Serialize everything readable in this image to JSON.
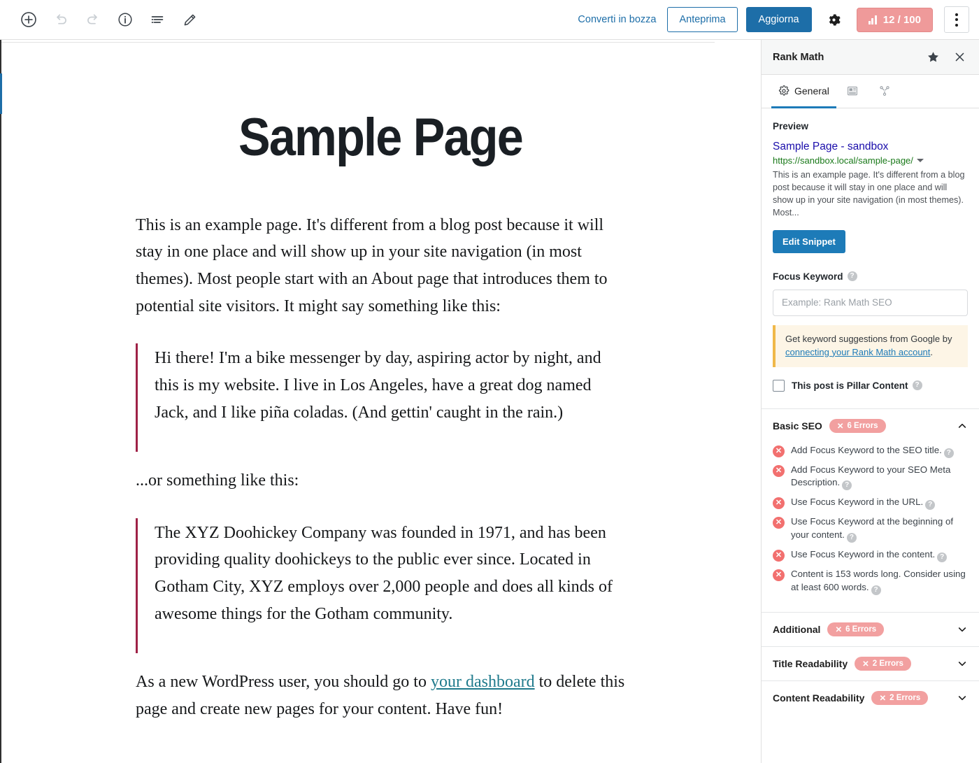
{
  "toolbar": {
    "icons": [
      {
        "name": "add-block-icon",
        "label": "Aggiungi blocco"
      },
      {
        "name": "undo-icon",
        "label": "Annulla"
      },
      {
        "name": "redo-icon",
        "label": "Ripeti"
      },
      {
        "name": "info-icon",
        "label": "Dettagli"
      },
      {
        "name": "list-view-icon",
        "label": "Vista elenco"
      },
      {
        "name": "edit-pencil-icon",
        "label": "Modifica"
      }
    ],
    "switch_to_draft": "Converti in bozza",
    "preview": "Anteprima",
    "update": "Aggiorna",
    "settings_icon": "gear-icon",
    "seo_score": "12 / 100",
    "seo_score_icon": "seo-bars-icon",
    "more_icon": "kebab-menu-icon"
  },
  "editor": {
    "title": "Sample Page",
    "paragraph1": "This is an example page. It's different from a blog post because it will stay in one place and will show up in your site navigation (in most themes). Most people start with an About page that introduces them to potential site visitors. It might say something like this:",
    "quote1": "Hi there! I'm a bike messenger by day, aspiring actor by night, and this is my website. I live in Los Angeles, have a great dog named Jack, and I like piña coladas. (And gettin' caught in the rain.)",
    "paragraph2": "...or something like this:",
    "quote2": "The XYZ Doohickey Company was founded in 1971, and has been providing quality doohickeys to the public ever since. Located in Gotham City, XYZ employs over 2,000 people and does all kinds of awesome things for the Gotham community.",
    "paragraph3_before": "As a new WordPress user, you should go to ",
    "paragraph3_link": "your dashboard",
    "paragraph3_after": " to delete this page and create new pages for your content. Have fun!"
  },
  "rank_math": {
    "panel_title": "Rank Math",
    "star_icon": "star-icon",
    "close_icon": "close-icon",
    "tabs": [
      {
        "label": "General",
        "icon": "gear-icon",
        "active": true
      },
      {
        "label": "",
        "icon": "schema-article-icon",
        "active": false
      },
      {
        "label": "",
        "icon": "social-share-icon",
        "active": false
      }
    ],
    "preview": {
      "heading": "Preview",
      "snippet_title": "Sample Page - sandbox",
      "snippet_url": "https://sandbox.local/sample-page/",
      "snippet_description": "This is an example page. It's different from a blog post because it will stay in one place and will show up in your site navigation (in most themes). Most...",
      "edit_snippet_button": "Edit Snippet"
    },
    "focus_keyword": {
      "label": "Focus Keyword",
      "placeholder": "Example: Rank Math SEO",
      "value": "",
      "notice_before": "Get keyword suggestions from Google by ",
      "notice_link": "connecting your Rank Math account",
      "notice_after": ".",
      "pillar_label": "This post is Pillar Content",
      "pillar_checked": false
    },
    "sections": [
      {
        "name": "Basic SEO",
        "badge": "6 Errors",
        "expanded": true,
        "items": [
          "Add Focus Keyword to the SEO title.",
          "Add Focus Keyword to your SEO Meta Description.",
          "Use Focus Keyword in the URL.",
          "Use Focus Keyword at the beginning of your content.",
          "Use Focus Keyword in the content.",
          "Content is 153 words long. Consider using at least 600 words."
        ]
      },
      {
        "name": "Additional",
        "badge": "6 Errors",
        "expanded": false,
        "items": []
      },
      {
        "name": "Title Readability",
        "badge": "2 Errors",
        "expanded": false,
        "items": []
      },
      {
        "name": "Content Readability",
        "badge": "2 Errors",
        "expanded": false,
        "items": []
      }
    ]
  },
  "colors": {
    "accent_blue": "#1d6ea8",
    "tab_active": "#1d7bb8",
    "error_badge": "#f2a0a0",
    "error_icon": "#f2706f",
    "score_badge": "#ef9a9a",
    "quote_border": "#9f2247",
    "snippet_title": "#1a0dab",
    "snippet_url": "#1a7a1a",
    "link_teal": "#1f7a8c"
  }
}
